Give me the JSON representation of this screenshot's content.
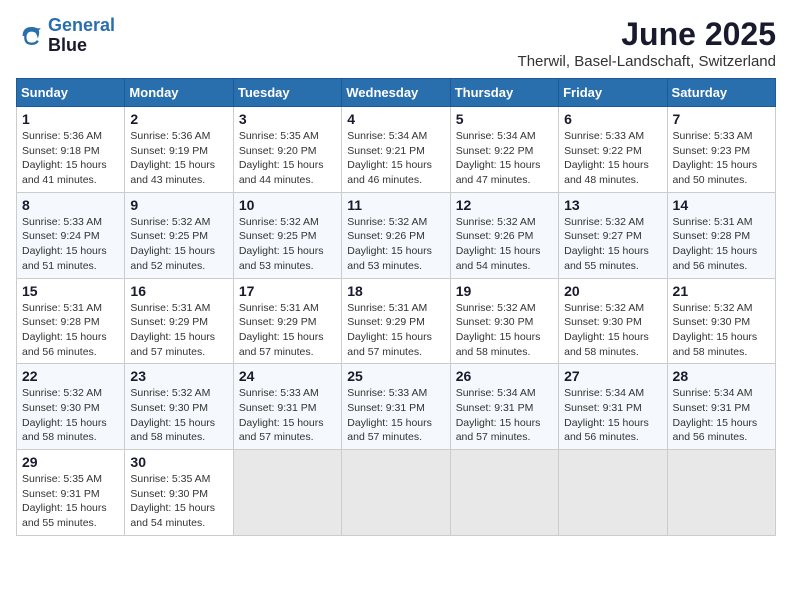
{
  "header": {
    "logo_line1": "General",
    "logo_line2": "Blue",
    "title": "June 2025",
    "subtitle": "Therwil, Basel-Landschaft, Switzerland"
  },
  "calendar": {
    "weekdays": [
      "Sunday",
      "Monday",
      "Tuesday",
      "Wednesday",
      "Thursday",
      "Friday",
      "Saturday"
    ],
    "weeks": [
      [
        {
          "day": "1",
          "rise": "Sunrise: 5:36 AM",
          "set": "Sunset: 9:18 PM",
          "daylight": "Daylight: 15 hours and 41 minutes."
        },
        {
          "day": "2",
          "rise": "Sunrise: 5:36 AM",
          "set": "Sunset: 9:19 PM",
          "daylight": "Daylight: 15 hours and 43 minutes."
        },
        {
          "day": "3",
          "rise": "Sunrise: 5:35 AM",
          "set": "Sunset: 9:20 PM",
          "daylight": "Daylight: 15 hours and 44 minutes."
        },
        {
          "day": "4",
          "rise": "Sunrise: 5:34 AM",
          "set": "Sunset: 9:21 PM",
          "daylight": "Daylight: 15 hours and 46 minutes."
        },
        {
          "day": "5",
          "rise": "Sunrise: 5:34 AM",
          "set": "Sunset: 9:22 PM",
          "daylight": "Daylight: 15 hours and 47 minutes."
        },
        {
          "day": "6",
          "rise": "Sunrise: 5:33 AM",
          "set": "Sunset: 9:22 PM",
          "daylight": "Daylight: 15 hours and 48 minutes."
        },
        {
          "day": "7",
          "rise": "Sunrise: 5:33 AM",
          "set": "Sunset: 9:23 PM",
          "daylight": "Daylight: 15 hours and 50 minutes."
        }
      ],
      [
        {
          "day": "8",
          "rise": "Sunrise: 5:33 AM",
          "set": "Sunset: 9:24 PM",
          "daylight": "Daylight: 15 hours and 51 minutes."
        },
        {
          "day": "9",
          "rise": "Sunrise: 5:32 AM",
          "set": "Sunset: 9:25 PM",
          "daylight": "Daylight: 15 hours and 52 minutes."
        },
        {
          "day": "10",
          "rise": "Sunrise: 5:32 AM",
          "set": "Sunset: 9:25 PM",
          "daylight": "Daylight: 15 hours and 53 minutes."
        },
        {
          "day": "11",
          "rise": "Sunrise: 5:32 AM",
          "set": "Sunset: 9:26 PM",
          "daylight": "Daylight: 15 hours and 53 minutes."
        },
        {
          "day": "12",
          "rise": "Sunrise: 5:32 AM",
          "set": "Sunset: 9:26 PM",
          "daylight": "Daylight: 15 hours and 54 minutes."
        },
        {
          "day": "13",
          "rise": "Sunrise: 5:32 AM",
          "set": "Sunset: 9:27 PM",
          "daylight": "Daylight: 15 hours and 55 minutes."
        },
        {
          "day": "14",
          "rise": "Sunrise: 5:31 AM",
          "set": "Sunset: 9:28 PM",
          "daylight": "Daylight: 15 hours and 56 minutes."
        }
      ],
      [
        {
          "day": "15",
          "rise": "Sunrise: 5:31 AM",
          "set": "Sunset: 9:28 PM",
          "daylight": "Daylight: 15 hours and 56 minutes."
        },
        {
          "day": "16",
          "rise": "Sunrise: 5:31 AM",
          "set": "Sunset: 9:29 PM",
          "daylight": "Daylight: 15 hours and 57 minutes."
        },
        {
          "day": "17",
          "rise": "Sunrise: 5:31 AM",
          "set": "Sunset: 9:29 PM",
          "daylight": "Daylight: 15 hours and 57 minutes."
        },
        {
          "day": "18",
          "rise": "Sunrise: 5:31 AM",
          "set": "Sunset: 9:29 PM",
          "daylight": "Daylight: 15 hours and 57 minutes."
        },
        {
          "day": "19",
          "rise": "Sunrise: 5:32 AM",
          "set": "Sunset: 9:30 PM",
          "daylight": "Daylight: 15 hours and 58 minutes."
        },
        {
          "day": "20",
          "rise": "Sunrise: 5:32 AM",
          "set": "Sunset: 9:30 PM",
          "daylight": "Daylight: 15 hours and 58 minutes."
        },
        {
          "day": "21",
          "rise": "Sunrise: 5:32 AM",
          "set": "Sunset: 9:30 PM",
          "daylight": "Daylight: 15 hours and 58 minutes."
        }
      ],
      [
        {
          "day": "22",
          "rise": "Sunrise: 5:32 AM",
          "set": "Sunset: 9:30 PM",
          "daylight": "Daylight: 15 hours and 58 minutes."
        },
        {
          "day": "23",
          "rise": "Sunrise: 5:32 AM",
          "set": "Sunset: 9:30 PM",
          "daylight": "Daylight: 15 hours and 58 minutes."
        },
        {
          "day": "24",
          "rise": "Sunrise: 5:33 AM",
          "set": "Sunset: 9:31 PM",
          "daylight": "Daylight: 15 hours and 57 minutes."
        },
        {
          "day": "25",
          "rise": "Sunrise: 5:33 AM",
          "set": "Sunset: 9:31 PM",
          "daylight": "Daylight: 15 hours and 57 minutes."
        },
        {
          "day": "26",
          "rise": "Sunrise: 5:34 AM",
          "set": "Sunset: 9:31 PM",
          "daylight": "Daylight: 15 hours and 57 minutes."
        },
        {
          "day": "27",
          "rise": "Sunrise: 5:34 AM",
          "set": "Sunset: 9:31 PM",
          "daylight": "Daylight: 15 hours and 56 minutes."
        },
        {
          "day": "28",
          "rise": "Sunrise: 5:34 AM",
          "set": "Sunset: 9:31 PM",
          "daylight": "Daylight: 15 hours and 56 minutes."
        }
      ],
      [
        {
          "day": "29",
          "rise": "Sunrise: 5:35 AM",
          "set": "Sunset: 9:31 PM",
          "daylight": "Daylight: 15 hours and 55 minutes."
        },
        {
          "day": "30",
          "rise": "Sunrise: 5:35 AM",
          "set": "Sunset: 9:30 PM",
          "daylight": "Daylight: 15 hours and 54 minutes."
        },
        null,
        null,
        null,
        null,
        null
      ]
    ]
  }
}
